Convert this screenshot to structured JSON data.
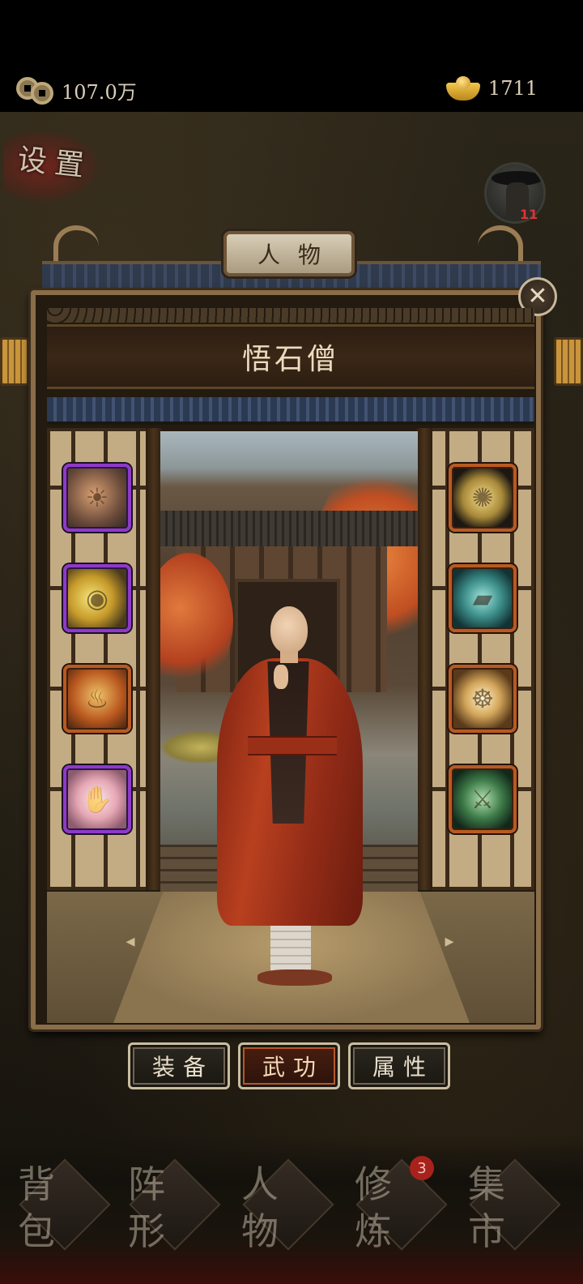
{
  "status_bar": {
    "coins": "107.0万",
    "gold": "1711"
  },
  "settings_label": "设置",
  "avatar_badge": "11",
  "panel": {
    "tab_title": "人物",
    "character_name": "悟石僧",
    "close_icon": "close-icon",
    "left_skills": [
      {
        "icon": "lion-roar-skill-icon",
        "rarity": "purple"
      },
      {
        "icon": "golden-light-skill-icon",
        "rarity": "purple"
      },
      {
        "icon": "dragon-skill-icon",
        "rarity": "orange"
      },
      {
        "icon": "buddha-palm-skill-icon",
        "rarity": "purple"
      }
    ],
    "right_skills": [
      {
        "icon": "golden-emblem-skill-icon",
        "rarity": "orange"
      },
      {
        "icon": "scroll-skill-icon",
        "rarity": "orange"
      },
      {
        "icon": "meditating-buddha-skill-icon",
        "rarity": "orange"
      },
      {
        "icon": "combat-stance-skill-icon",
        "rarity": "orange"
      }
    ],
    "arrow_left": "◂",
    "arrow_right": "▸",
    "tabs": [
      {
        "label": "装备",
        "active": false
      },
      {
        "label": "武功",
        "active": true
      },
      {
        "label": "属性",
        "active": false
      }
    ]
  },
  "bottom_nav": [
    {
      "label": "背包",
      "badge": ""
    },
    {
      "label": "阵形",
      "badge": ""
    },
    {
      "label": "人物",
      "badge": ""
    },
    {
      "label": "修炼",
      "badge": "3"
    },
    {
      "label": "集市",
      "badge": ""
    }
  ],
  "colors": {
    "purple_rarity": "#8e3ac9",
    "orange_rarity": "#b85a22",
    "active_tab": "#b4582b",
    "badge_red": "#a8221c"
  }
}
